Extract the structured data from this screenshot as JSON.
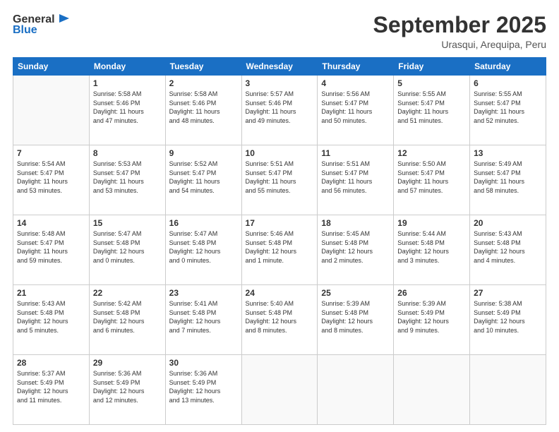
{
  "logo": {
    "line1": "General",
    "line2": "Blue"
  },
  "header": {
    "month": "September 2025",
    "location": "Urasqui, Arequipa, Peru"
  },
  "weekdays": [
    "Sunday",
    "Monday",
    "Tuesday",
    "Wednesday",
    "Thursday",
    "Friday",
    "Saturday"
  ],
  "weeks": [
    [
      {
        "day": "",
        "info": ""
      },
      {
        "day": "1",
        "info": "Sunrise: 5:58 AM\nSunset: 5:46 PM\nDaylight: 11 hours\nand 47 minutes."
      },
      {
        "day": "2",
        "info": "Sunrise: 5:58 AM\nSunset: 5:46 PM\nDaylight: 11 hours\nand 48 minutes."
      },
      {
        "day": "3",
        "info": "Sunrise: 5:57 AM\nSunset: 5:46 PM\nDaylight: 11 hours\nand 49 minutes."
      },
      {
        "day": "4",
        "info": "Sunrise: 5:56 AM\nSunset: 5:47 PM\nDaylight: 11 hours\nand 50 minutes."
      },
      {
        "day": "5",
        "info": "Sunrise: 5:55 AM\nSunset: 5:47 PM\nDaylight: 11 hours\nand 51 minutes."
      },
      {
        "day": "6",
        "info": "Sunrise: 5:55 AM\nSunset: 5:47 PM\nDaylight: 11 hours\nand 52 minutes."
      }
    ],
    [
      {
        "day": "7",
        "info": "Sunrise: 5:54 AM\nSunset: 5:47 PM\nDaylight: 11 hours\nand 53 minutes."
      },
      {
        "day": "8",
        "info": "Sunrise: 5:53 AM\nSunset: 5:47 PM\nDaylight: 11 hours\nand 53 minutes."
      },
      {
        "day": "9",
        "info": "Sunrise: 5:52 AM\nSunset: 5:47 PM\nDaylight: 11 hours\nand 54 minutes."
      },
      {
        "day": "10",
        "info": "Sunrise: 5:51 AM\nSunset: 5:47 PM\nDaylight: 11 hours\nand 55 minutes."
      },
      {
        "day": "11",
        "info": "Sunrise: 5:51 AM\nSunset: 5:47 PM\nDaylight: 11 hours\nand 56 minutes."
      },
      {
        "day": "12",
        "info": "Sunrise: 5:50 AM\nSunset: 5:47 PM\nDaylight: 11 hours\nand 57 minutes."
      },
      {
        "day": "13",
        "info": "Sunrise: 5:49 AM\nSunset: 5:47 PM\nDaylight: 11 hours\nand 58 minutes."
      }
    ],
    [
      {
        "day": "14",
        "info": "Sunrise: 5:48 AM\nSunset: 5:47 PM\nDaylight: 11 hours\nand 59 minutes."
      },
      {
        "day": "15",
        "info": "Sunrise: 5:47 AM\nSunset: 5:48 PM\nDaylight: 12 hours\nand 0 minutes."
      },
      {
        "day": "16",
        "info": "Sunrise: 5:47 AM\nSunset: 5:48 PM\nDaylight: 12 hours\nand 0 minutes."
      },
      {
        "day": "17",
        "info": "Sunrise: 5:46 AM\nSunset: 5:48 PM\nDaylight: 12 hours\nand 1 minute."
      },
      {
        "day": "18",
        "info": "Sunrise: 5:45 AM\nSunset: 5:48 PM\nDaylight: 12 hours\nand 2 minutes."
      },
      {
        "day": "19",
        "info": "Sunrise: 5:44 AM\nSunset: 5:48 PM\nDaylight: 12 hours\nand 3 minutes."
      },
      {
        "day": "20",
        "info": "Sunrise: 5:43 AM\nSunset: 5:48 PM\nDaylight: 12 hours\nand 4 minutes."
      }
    ],
    [
      {
        "day": "21",
        "info": "Sunrise: 5:43 AM\nSunset: 5:48 PM\nDaylight: 12 hours\nand 5 minutes."
      },
      {
        "day": "22",
        "info": "Sunrise: 5:42 AM\nSunset: 5:48 PM\nDaylight: 12 hours\nand 6 minutes."
      },
      {
        "day": "23",
        "info": "Sunrise: 5:41 AM\nSunset: 5:48 PM\nDaylight: 12 hours\nand 7 minutes."
      },
      {
        "day": "24",
        "info": "Sunrise: 5:40 AM\nSunset: 5:48 PM\nDaylight: 12 hours\nand 8 minutes."
      },
      {
        "day": "25",
        "info": "Sunrise: 5:39 AM\nSunset: 5:48 PM\nDaylight: 12 hours\nand 8 minutes."
      },
      {
        "day": "26",
        "info": "Sunrise: 5:39 AM\nSunset: 5:49 PM\nDaylight: 12 hours\nand 9 minutes."
      },
      {
        "day": "27",
        "info": "Sunrise: 5:38 AM\nSunset: 5:49 PM\nDaylight: 12 hours\nand 10 minutes."
      }
    ],
    [
      {
        "day": "28",
        "info": "Sunrise: 5:37 AM\nSunset: 5:49 PM\nDaylight: 12 hours\nand 11 minutes."
      },
      {
        "day": "29",
        "info": "Sunrise: 5:36 AM\nSunset: 5:49 PM\nDaylight: 12 hours\nand 12 minutes."
      },
      {
        "day": "30",
        "info": "Sunrise: 5:36 AM\nSunset: 5:49 PM\nDaylight: 12 hours\nand 13 minutes."
      },
      {
        "day": "",
        "info": ""
      },
      {
        "day": "",
        "info": ""
      },
      {
        "day": "",
        "info": ""
      },
      {
        "day": "",
        "info": ""
      }
    ]
  ]
}
